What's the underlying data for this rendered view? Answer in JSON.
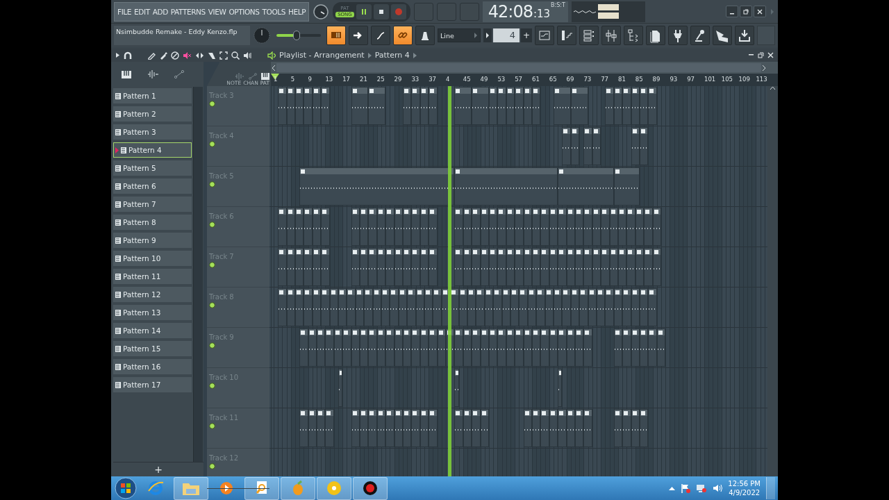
{
  "menu": [
    "FILE",
    "EDIT",
    "ADD",
    "PATTERNS",
    "VIEW",
    "OPTIONS",
    "TOOLS",
    "HELP"
  ],
  "transport": {
    "modes": [
      {
        "label": "PAT",
        "selected": false
      },
      {
        "label": "SONG",
        "selected": true
      }
    ]
  },
  "time": {
    "main": "42:08",
    "sub": ":13",
    "label": "B:S:T"
  },
  "project_title": "Nsimbudde Remake - Eddy Kenzo.flp",
  "master_slider": {
    "level": 0.45
  },
  "toolbar": [
    {
      "on": true
    },
    {
      "on": false
    },
    {
      "on": false
    },
    {
      "on": true
    },
    {
      "on": false
    }
  ],
  "snap": {
    "value": "Line"
  },
  "stepper": {
    "value": "4",
    "plus": "+"
  },
  "playlist": {
    "title": "Playlist - Arrangement",
    "pattern": "Pattern 4",
    "header_labels": [
      "NOTE",
      "CHAN",
      "PAT"
    ],
    "ruler": [
      "1",
      "5",
      "9",
      "13",
      "17",
      "21",
      "25",
      "29",
      "33",
      "37",
      "4",
      "45",
      "49",
      "53",
      "57",
      "61",
      "65",
      "69",
      "73",
      "77",
      "81",
      "85",
      "89",
      "93",
      "97",
      "101",
      "105",
      "109",
      "113"
    ],
    "playhead": {
      "level": 0.358
    },
    "tracks": [
      "Track 3",
      "Track 4",
      "Track 5",
      "Track 6",
      "Track 7",
      "Track 8",
      "Track 9",
      "Track 10",
      "Track 11",
      "Track 12"
    ]
  },
  "patterns": [
    {
      "label": "Pattern 1",
      "selected": false
    },
    {
      "label": "Pattern 2",
      "selected": false
    },
    {
      "label": "Pattern 3",
      "selected": false
    },
    {
      "label": "Pattern 4",
      "selected": true
    },
    {
      "label": "Pattern 5",
      "selected": false
    },
    {
      "label": "Pattern 6",
      "selected": false
    },
    {
      "label": "Pattern 7",
      "selected": false
    },
    {
      "label": "Pattern 8",
      "selected": false
    },
    {
      "label": "Pattern 9",
      "selected": false
    },
    {
      "label": "Pattern 10",
      "selected": false
    },
    {
      "label": "Pattern 11",
      "selected": false
    },
    {
      "label": "Pattern 12",
      "selected": false
    },
    {
      "label": "Pattern 13",
      "selected": false
    },
    {
      "label": "Pattern 14",
      "selected": false
    },
    {
      "label": "Pattern 15",
      "selected": false
    },
    {
      "label": "Pattern 16",
      "selected": false
    },
    {
      "label": "Pattern 17",
      "selected": false
    }
  ],
  "add_button": "+",
  "taskbar": {
    "clock": {
      "time": "12:56 PM",
      "date": "4/9/2022"
    }
  }
}
